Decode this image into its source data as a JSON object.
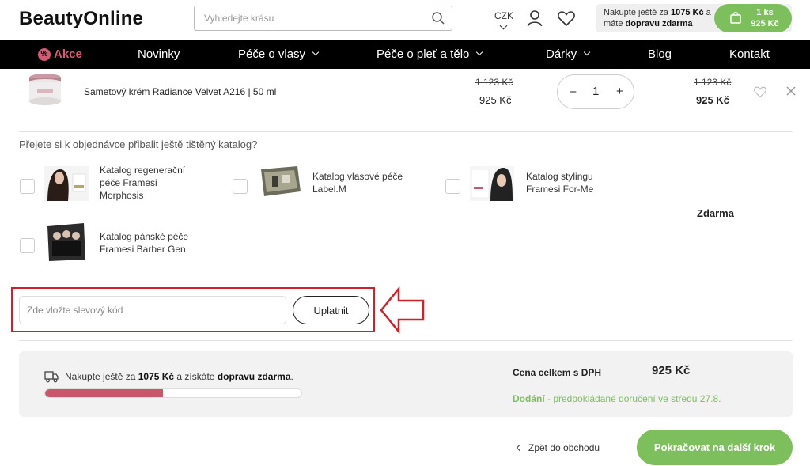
{
  "header": {
    "logo": "BeautyOnline",
    "search_placeholder": "Vyhledejte krásu",
    "currency": "CZK",
    "shipping_prefix": "Nakupte ještě za ",
    "shipping_amount": "1075 Kč",
    "shipping_mid": " a",
    "shipping_line2_prefix": "máte ",
    "shipping_line2_bold": "dopravu zdarma",
    "cart_count": "1 ks",
    "cart_total": "925 Kč"
  },
  "nav": {
    "items": [
      {
        "label": "Akce",
        "icon": "percent-icon"
      },
      {
        "label": "Novinky"
      },
      {
        "label": "Péče o vlasy",
        "dropdown": true
      },
      {
        "label": "Péče o pleť a tělo",
        "dropdown": true
      },
      {
        "label": "Dárky",
        "dropdown": true
      },
      {
        "label": "Blog"
      },
      {
        "label": "Kontakt"
      }
    ]
  },
  "cart_item": {
    "name": "Sametový krém Radiance Velvet A216 | 50 ml",
    "unit_old_price": "1 123 Kč",
    "unit_price": "925 Kč",
    "quantity": "1",
    "minus": "–",
    "plus": "+",
    "total_old_price": "1 123 Kč",
    "total_price": "925 Kč"
  },
  "catalogs": {
    "question": "Přejete si k objednávce přibalit ještě tištěný katalog?",
    "items": [
      {
        "label": "Katalog regenerační péče Framesi Morphosis"
      },
      {
        "label": "Katalog vlasové péče Label.M"
      },
      {
        "label": "Katalog stylingu Framesi For-Me"
      },
      {
        "label": "Katalog pánské péče Framesi Barber Gen"
      }
    ],
    "price": "Zdarma"
  },
  "coupon": {
    "placeholder": "Zde vložte slevový kód",
    "apply_label": "Uplatnit"
  },
  "summary": {
    "ship_prefix": "Nakupte ještě za ",
    "ship_amount": "1075 Kč",
    "ship_mid": " a získáte ",
    "ship_bold": "dopravu zdarma",
    "ship_suffix": ".",
    "progress_percent": 46,
    "total_label": "Cena celkem s DPH",
    "total_value": "925 Kč",
    "delivery_label": "Dodání",
    "delivery_text": " - předpokládané doručení ve středu 27.8."
  },
  "footer": {
    "back_label": "Zpět do obchodu",
    "continue_label": "Pokračovat na další krok"
  },
  "colors": {
    "accent_green": "#7cbf5c",
    "accent_pink": "#d35b73",
    "highlight_red": "#d0202a"
  }
}
